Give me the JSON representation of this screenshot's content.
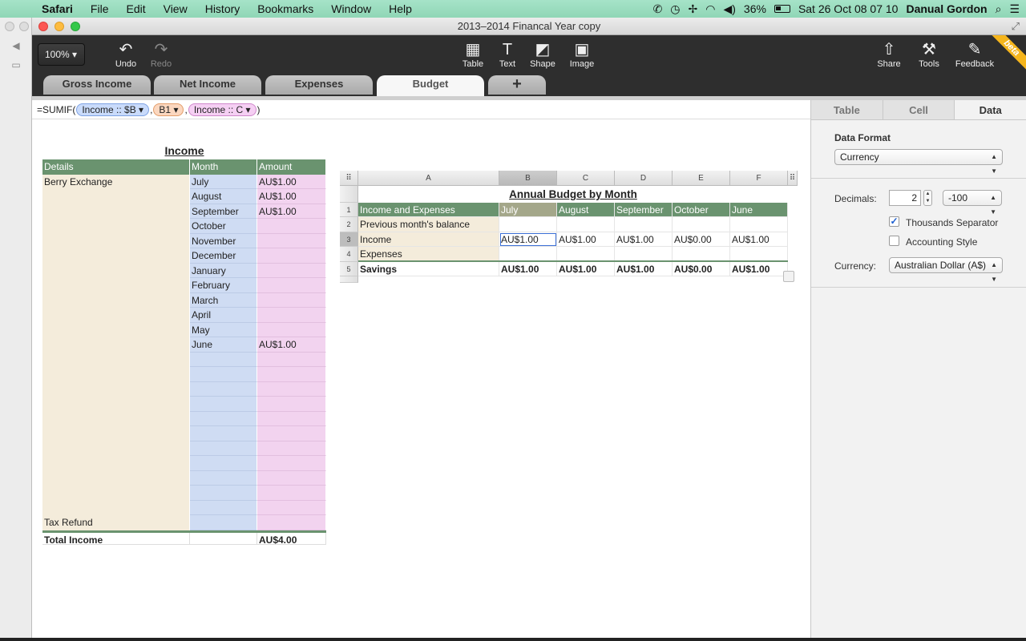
{
  "menubar": {
    "app": "Safari",
    "items": [
      "File",
      "Edit",
      "View",
      "History",
      "Bookmarks",
      "Window",
      "Help"
    ],
    "battery": "36%",
    "clock": "Sat 26 Oct  08 07 10",
    "user": "Danual Gordon"
  },
  "window": {
    "title": "2013–2014 Financal Year copy"
  },
  "toolbar": {
    "zoom": "100%",
    "undo": "Undo",
    "redo": "Redo",
    "table": "Table",
    "text": "Text",
    "shape": "Shape",
    "image": "Image",
    "share": "Share",
    "tools": "Tools",
    "feedback": "Feedback",
    "beta": "beta"
  },
  "tabs": [
    "Gross Income",
    "Net Income",
    "Expenses",
    "Budget"
  ],
  "formula": {
    "prefix": "=SUMIF(",
    "token1": "Income :: $B",
    "sep": ",",
    "token2": "B1",
    "token3": "Income :: C",
    "suffix": ")"
  },
  "income": {
    "title": "Income",
    "headers": [
      "Details",
      "Month",
      "Amount"
    ],
    "first_detail": "Berry Exchange",
    "last_detail": "Tax Refund",
    "months": [
      "July",
      "August",
      "September",
      "October",
      "November",
      "December",
      "January",
      "February",
      "March",
      "April",
      "May",
      "June"
    ],
    "amounts": [
      "AU$1.00",
      "AU$1.00",
      "AU$1.00",
      "",
      "",
      "",
      "",
      "",
      "",
      "",
      "",
      "AU$1.00"
    ],
    "total_label": "Total Income",
    "total_value": "AU$4.00"
  },
  "budget": {
    "title": "Annual Budget by Month",
    "columns": [
      "A",
      "B",
      "C",
      "D",
      "E",
      "F"
    ],
    "rows": [
      "1",
      "2",
      "3",
      "4",
      "5"
    ],
    "header": [
      "Income and Expenses",
      "July",
      "August",
      "September",
      "October",
      "June"
    ],
    "prev_label": "Previous month's balance",
    "income_label": "Income",
    "income_values": [
      "AU$1.00",
      "AU$1.00",
      "AU$1.00",
      "AU$0.00",
      "AU$1.00"
    ],
    "expenses_label": "Expenses",
    "savings_label": "Savings",
    "savings_values": [
      "AU$1.00",
      "AU$1.00",
      "AU$1.00",
      "AU$0.00",
      "AU$1.00"
    ]
  },
  "inspector": {
    "tabs": [
      "Table",
      "Cell",
      "Data"
    ],
    "data_format_label": "Data Format",
    "data_format_value": "Currency",
    "decimals_label": "Decimals:",
    "decimals_value": "2",
    "negative_format": "-100",
    "thousands_label": "Thousands Separator",
    "thousands_checked": true,
    "accounting_label": "Accounting Style",
    "accounting_checked": false,
    "currency_label": "Currency:",
    "currency_value": "Australian Dollar (A$)"
  }
}
